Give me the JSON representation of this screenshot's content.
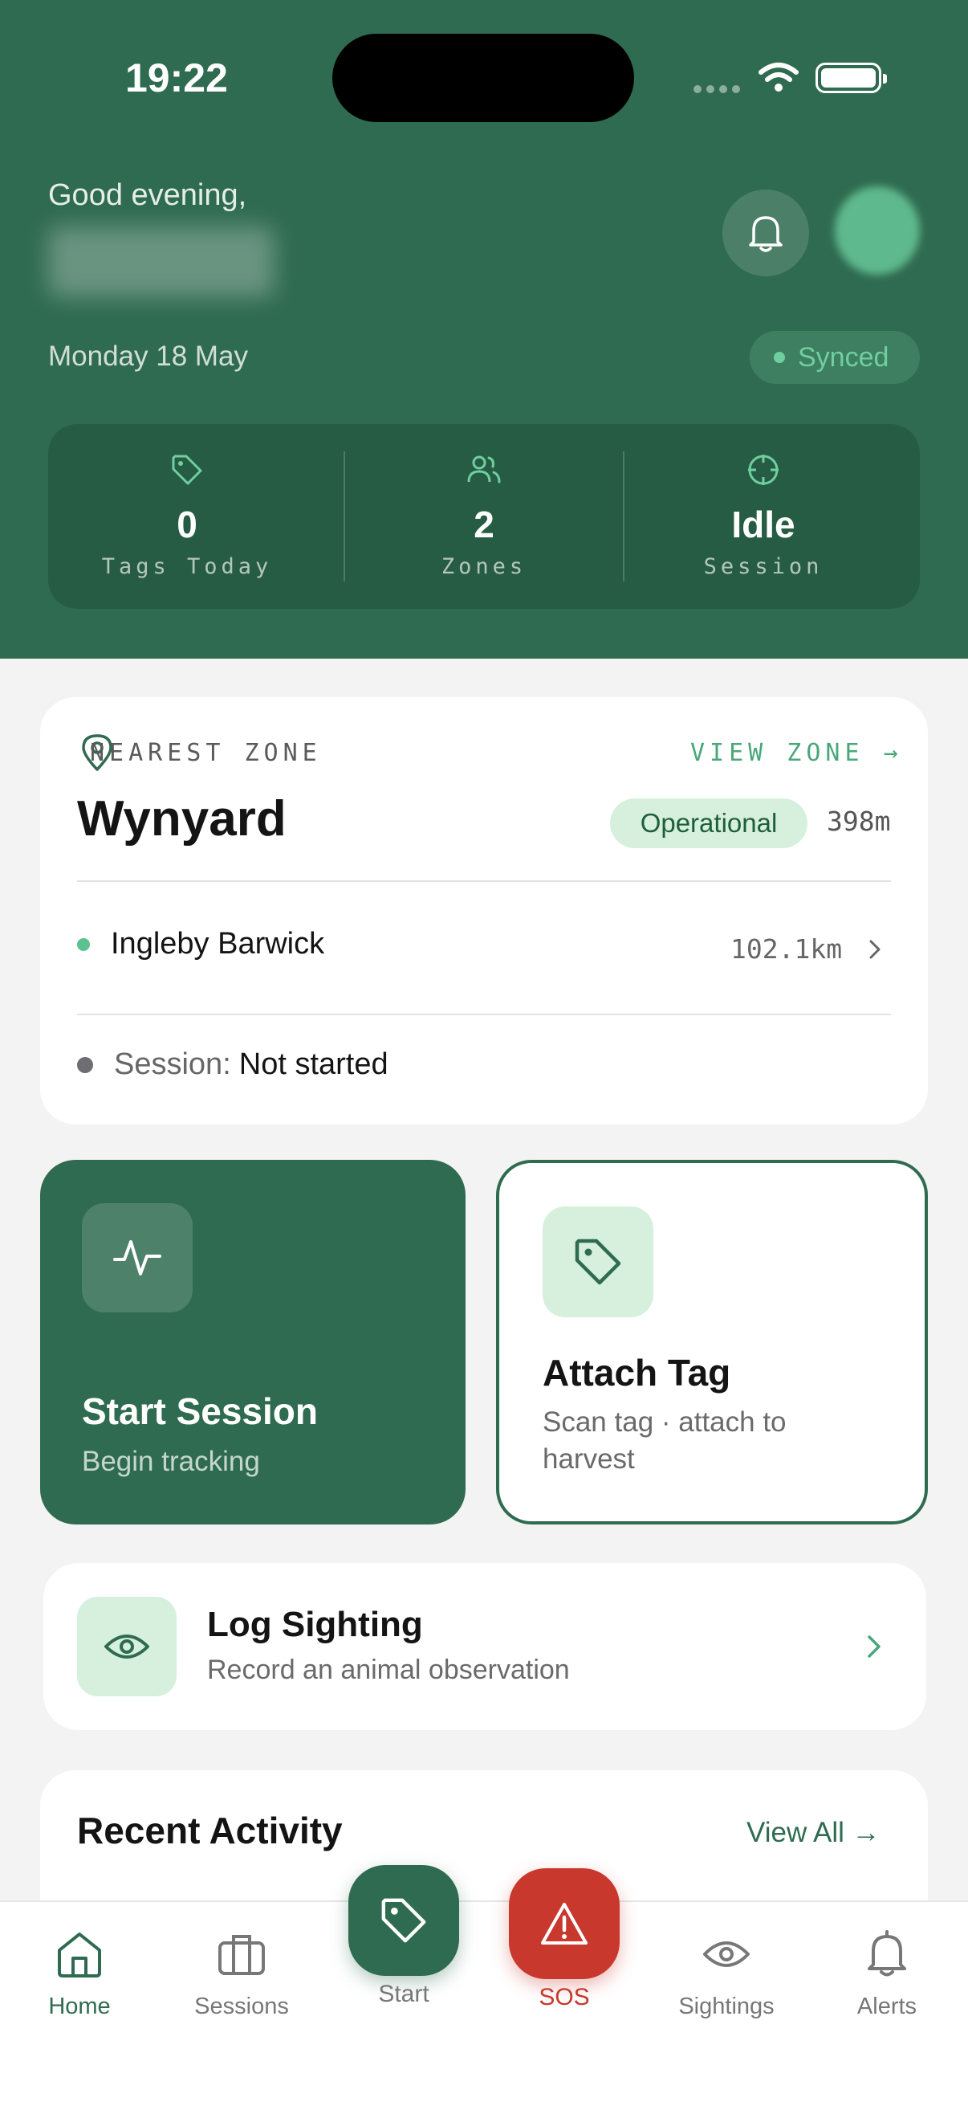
{
  "status_bar": {
    "time": "19:22"
  },
  "header": {
    "greeting": "Good evening,",
    "date": "Monday 18 May",
    "sync_status": "Synced",
    "stats": [
      {
        "icon": "tag-icon",
        "value": "0",
        "label": "Tags Today"
      },
      {
        "icon": "users-icon",
        "value": "2",
        "label": "Zones"
      },
      {
        "icon": "crosshair-icon",
        "value": "Idle",
        "label": "Session"
      }
    ]
  },
  "nearest_zone": {
    "label": "NEAREST ZONE",
    "view_link": "VIEW ZONE →",
    "name": "Wynyard",
    "status": "Operational",
    "distance": "398m",
    "other_zone": {
      "name": "Ingleby Barwick",
      "distance": "102.1km"
    },
    "session_label": "Session:",
    "session_value": "Not started"
  },
  "actions": {
    "start_session": {
      "title": "Start Session",
      "subtitle": "Begin tracking"
    },
    "attach_tag": {
      "title": "Attach Tag",
      "subtitle": "Scan tag · attach to harvest"
    },
    "log_sighting": {
      "title": "Log Sighting",
      "subtitle": "Record an animal observation"
    }
  },
  "recent_activity": {
    "title": "Recent Activity",
    "view_all": "View All →"
  },
  "tabbar": {
    "home": "Home",
    "sessions": "Sessions",
    "start": "Start",
    "sos": "SOS",
    "sightings": "Sightings",
    "alerts": "Alerts"
  },
  "colors": {
    "brand_green": "#2f6b50",
    "accent_green": "#5dc18f",
    "sos_red": "#c8382c",
    "light_green": "#d6f0dd"
  }
}
